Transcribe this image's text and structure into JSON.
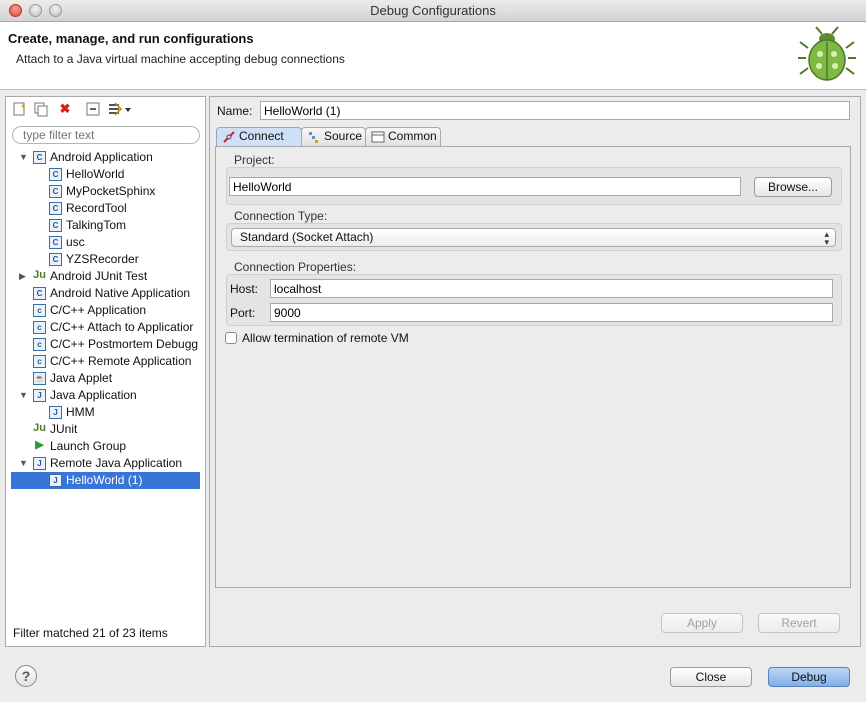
{
  "window": {
    "title": "Debug Configurations"
  },
  "header": {
    "title": "Create, manage, and run configurations",
    "subtitle": "Attach to a Java virtual machine accepting debug connections"
  },
  "sidebar": {
    "filter_placeholder": "type filter text",
    "tree": [
      {
        "label": "Android Application",
        "expanded": true,
        "level": 0,
        "icon": "android-app-icon"
      },
      {
        "label": "HelloWorld",
        "level": 1,
        "icon": "android-app-icon"
      },
      {
        "label": "MyPocketSphinx",
        "level": 1,
        "icon": "android-app-icon"
      },
      {
        "label": "RecordTool",
        "level": 1,
        "icon": "android-app-icon"
      },
      {
        "label": "TalkingTom",
        "level": 1,
        "icon": "android-app-icon"
      },
      {
        "label": "usc",
        "level": 1,
        "icon": "android-app-icon"
      },
      {
        "label": "YZSRecorder",
        "level": 1,
        "icon": "android-app-icon"
      },
      {
        "label": "Android JUnit Test",
        "expanded": false,
        "level": 0,
        "icon": "junit-icon"
      },
      {
        "label": "Android Native Application",
        "level": 0,
        "icon": "android-app-icon"
      },
      {
        "label": "C/C++ Application",
        "level": 0,
        "icon": "c-app-icon"
      },
      {
        "label": "C/C++ Attach to Applicatior",
        "level": 0,
        "icon": "c-app-icon"
      },
      {
        "label": "C/C++ Postmortem Debugg",
        "level": 0,
        "icon": "c-app-icon"
      },
      {
        "label": "C/C++ Remote Application",
        "level": 0,
        "icon": "c-app-icon"
      },
      {
        "label": "Java Applet",
        "level": 0,
        "icon": "applet-icon"
      },
      {
        "label": "Java Application",
        "expanded": true,
        "level": 0,
        "icon": "java-app-icon"
      },
      {
        "label": "HMM",
        "level": 1,
        "icon": "java-app-icon"
      },
      {
        "label": "JUnit",
        "level": 0,
        "icon": "junit-icon"
      },
      {
        "label": "Launch Group",
        "level": 0,
        "icon": "launch-group-icon"
      },
      {
        "label": "Remote Java Application",
        "expanded": true,
        "level": 0,
        "icon": "remote-java-icon"
      },
      {
        "label": "HelloWorld (1)",
        "level": 1,
        "icon": "remote-java-icon",
        "selected": true
      }
    ],
    "status": "Filter matched 21 of 23 items"
  },
  "main": {
    "name_label": "Name:",
    "name_value": "HelloWorld (1)",
    "tabs": [
      {
        "label": "Connect",
        "icon": "connect-icon",
        "active": true
      },
      {
        "label": "Source",
        "icon": "source-icon"
      },
      {
        "label": "Common",
        "icon": "common-icon"
      }
    ],
    "project_label": "Project:",
    "project_value": "HelloWorld",
    "browse_label": "Browse...",
    "connection_type_label": "Connection Type:",
    "connection_type_value": "Standard (Socket Attach)",
    "connection_props_label": "Connection Properties:",
    "host_label": "Host:",
    "host_value": "localhost",
    "port_label": "Port:",
    "port_value": "9000",
    "allow_termination_label": "Allow termination of remote VM",
    "allow_termination_checked": false,
    "apply_label": "Apply",
    "revert_label": "Revert"
  },
  "footer": {
    "help_label": "?",
    "close_label": "Close",
    "debug_label": "Debug"
  }
}
